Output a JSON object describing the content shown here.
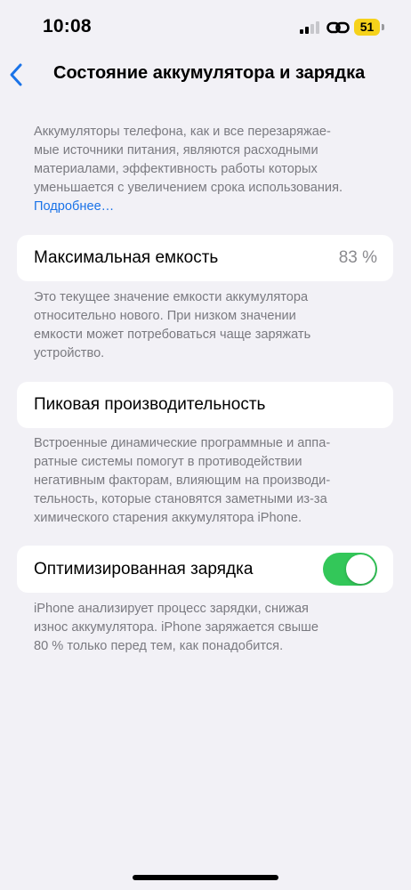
{
  "status_bar": {
    "time": "10:08",
    "battery_level": "51",
    "battery_color": "#f6d21b"
  },
  "nav": {
    "back_icon": "chevron-left-icon",
    "title": "Состояние аккумулятора и зарядка"
  },
  "intro": {
    "lines": [
      "Аккумуляторы телефона, как и все перезаряжае-",
      "мые источники питания, являются расходными",
      "материалами, эффективность работы которых",
      "уменьшается с увеличением срока использования."
    ],
    "more_link": "Подробнее…"
  },
  "max_capacity": {
    "label": "Максимальная емкость",
    "value": "83 %",
    "note_lines": [
      "Это текущее значение емкости аккумулятора",
      "относительно нового. При низком значении",
      "емкости может потребоваться чаще заряжать",
      "устройство."
    ]
  },
  "peak_performance": {
    "label": "Пиковая производительность",
    "note_lines": [
      "Встроенные динамические программные и аппа-",
      "ратные системы помогут в противодействии",
      "негативным факторам, влияющим на производи-",
      "тельность, которые становятся заметными из-за",
      "химического старения аккумулятора iPhone."
    ]
  },
  "optimized_charging": {
    "label": "Оптимизированная зарядка",
    "enabled": true,
    "toggle_color": "#33c759",
    "note_lines": [
      "iPhone анализирует процесс зарядки, снижая",
      "износ аккумулятора. iPhone заряжается свыше",
      "80 % только перед тем, как понадобится."
    ]
  }
}
